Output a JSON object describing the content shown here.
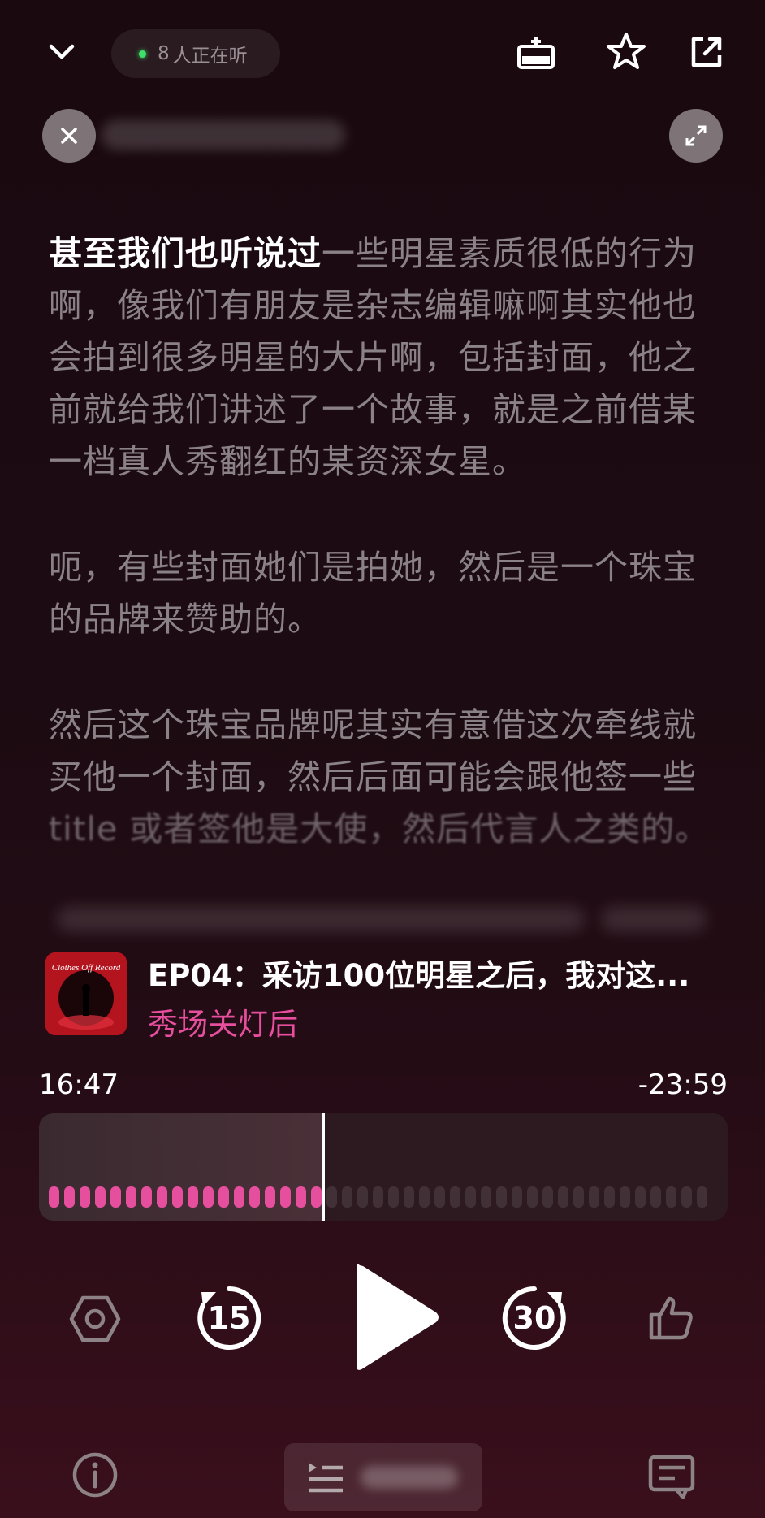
{
  "header": {
    "listeners_count": "8",
    "listeners_label": "人正在听"
  },
  "transcript": {
    "paragraphs": [
      {
        "highlighted": "甚至我们也听说过",
        "rest": "一些明星素质很低的行为啊，像我们有朋友是杂志编辑嘛啊其实他也会拍到很多明星的大片啊，包括封面，他之前就给我们讲述了一个故事，就是之前借某一档真人秀翻红的某资深女星。"
      },
      {
        "text": "呃，有些封面她们是拍她，然后是一个珠宝的品牌来赞助的。"
      },
      {
        "text": "然后这个珠宝品牌呢其实有意借这次牵线就买他一个封面，然后后面可能会跟他签一些",
        "faded": "title 或者签他是大使，然后代言人之类的。"
      }
    ]
  },
  "episode": {
    "title": "EP04：采访100位明星之后，我对这...",
    "show": "秀场关灯后",
    "cover_text": "Clothes Off Record"
  },
  "player": {
    "elapsed": "16:47",
    "remaining": "-23:59",
    "progress": 0.41,
    "skip_back_seconds": "15",
    "skip_forward_seconds": "30"
  },
  "colors": {
    "accent_pink": "#e64e9e",
    "live_green": "#3fe06a",
    "cover_red": "#b4141e"
  },
  "icons": {
    "collapse": "chevron-down-icon",
    "top_right": [
      "playlist-add-icon",
      "star-icon",
      "share-icon"
    ],
    "close": "close-icon",
    "expand": "expand-icon",
    "controls": [
      "settings-hexagon-icon",
      "skip-back-15-icon",
      "play-icon",
      "skip-forward-30-icon",
      "thumbs-up-icon"
    ],
    "bottom": [
      "info-icon",
      "queue-icon",
      "transcript-icon"
    ]
  }
}
